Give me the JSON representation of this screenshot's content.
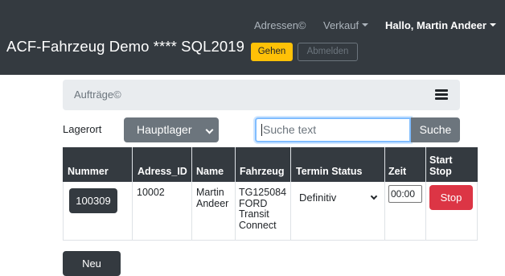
{
  "navbar": {
    "brand": "ACF-Fahrzeug Demo **** SQL2019",
    "links": {
      "adressen": "Adressen©",
      "verkauf": "Verkauf",
      "user": "Hallo, Martin Andeer"
    },
    "gehen_label": "Gehen",
    "abmelden_label": "Abmelden"
  },
  "breadcrumb": {
    "label": "Aufträge©",
    "icon": "menu-icon"
  },
  "filter": {
    "lagerort_label": "Lagerort",
    "lagerort_selected": "Hauptlager",
    "search_placeholder": "Suche text",
    "search_button": "Suche"
  },
  "table": {
    "headers": [
      "Nummer",
      "Adress_ID",
      "Name",
      "Fahrzeug",
      "Termin Status",
      "Zeit",
      "Start",
      "Stop"
    ],
    "rows": [
      {
        "nummer": "100309",
        "adress_id": "10002",
        "name_first": "Martin",
        "name_last": "Andeer",
        "fahrzeug": [
          "TG125084",
          "FORD",
          "Transit",
          "Connect"
        ],
        "termin_status": "Definitiv",
        "zeit": "00:00",
        "action": "Stop"
      }
    ]
  },
  "neu_label": "Neu",
  "colors": {
    "navbar": "#343a40",
    "warning": "#ffc107",
    "danger": "#dc3545",
    "secondary": "#6c757d"
  }
}
